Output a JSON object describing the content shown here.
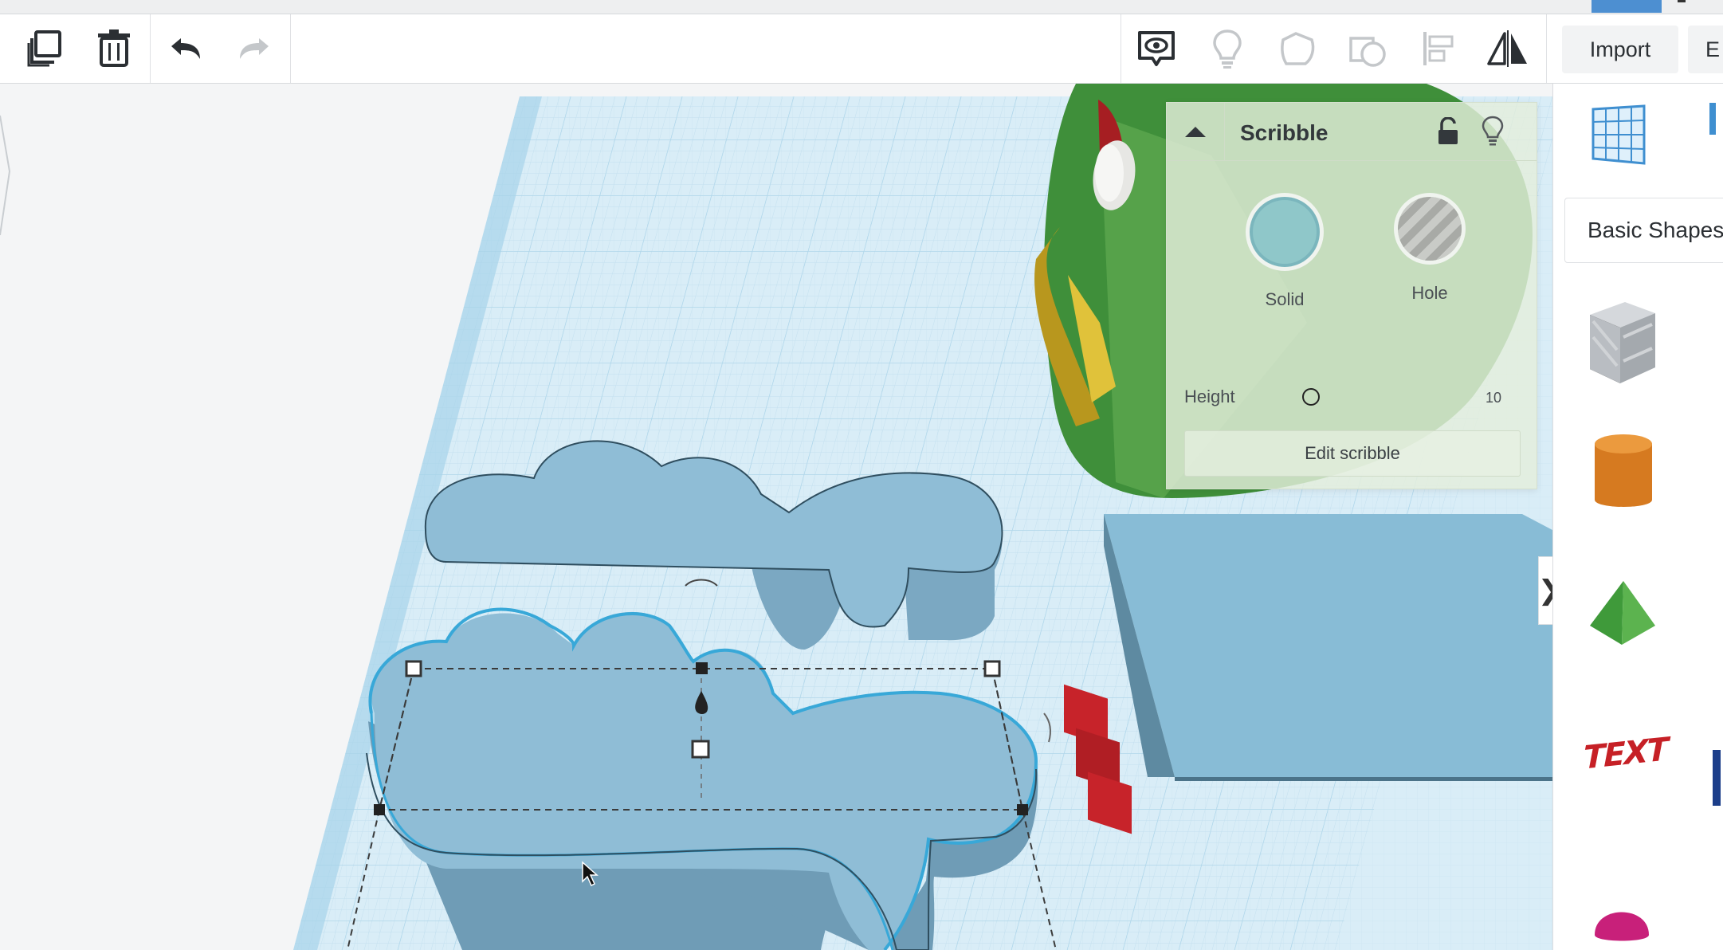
{
  "toolbar": {
    "import_label": "Import",
    "next_label": "E"
  },
  "inspector": {
    "title": "Scribble",
    "solid_label": "Solid",
    "hole_label": "Hole",
    "height_label": "Height",
    "height_value": "10",
    "edit_label": "Edit scribble"
  },
  "sidebar": {
    "category_label": "Basic Shapes",
    "text_shape_glyph": "TEXT"
  },
  "colors": {
    "shape_fill": "#8cbad4",
    "shape_side": "#6f9cb6",
    "grid_fill": "#d8ecf6",
    "grid_line": "#b6d9ec",
    "accent_blue": "#4d8fd1"
  },
  "icons": [
    "duplicate-icon",
    "trash-icon",
    "undo-icon",
    "redo-icon",
    "camera-view-icon",
    "bulb-icon",
    "group-icon",
    "ungroup-icon",
    "align-icon",
    "mirror-icon",
    "chevron-up-icon",
    "lock-icon",
    "bulb-small-icon",
    "workplane-icon",
    "box-icon",
    "cylinder-icon",
    "pyramid-icon",
    "text-icon",
    "half-sphere-icon",
    "chevron-right-icon",
    "cursor-icon"
  ]
}
